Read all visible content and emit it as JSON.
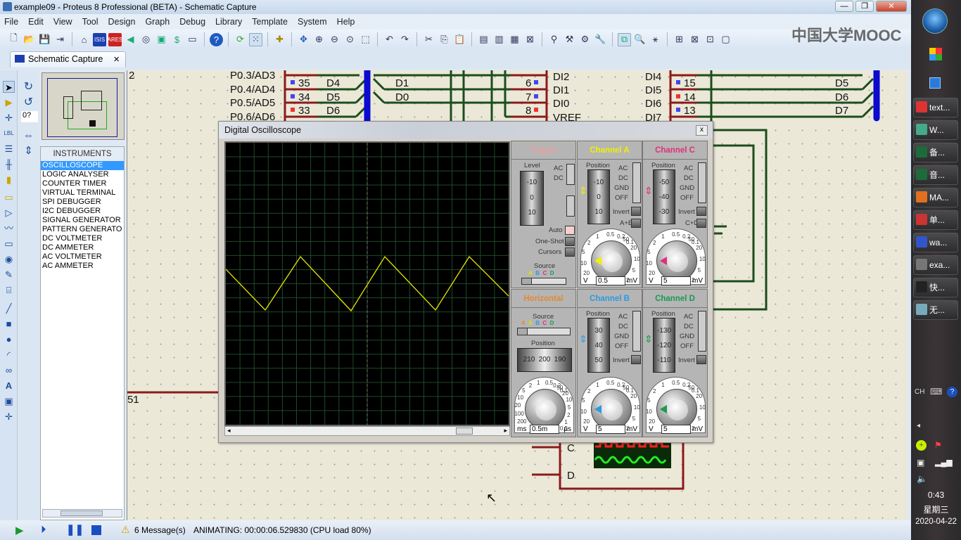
{
  "window": {
    "title": "example09 - Proteus 8 Professional (BETA) - Schematic Capture",
    "minimize": "—",
    "maximize": "❐",
    "close": "✕"
  },
  "menu": [
    "File",
    "Edit",
    "View",
    "Tool",
    "Design",
    "Graph",
    "Debug",
    "Library",
    "Template",
    "System",
    "Help"
  ],
  "watermark": "中国大学MOOC",
  "tab": {
    "label": "Schematic Capture",
    "close": "×"
  },
  "sidebar": {
    "rotation_field": "0?"
  },
  "instruments": {
    "header": "INSTRUMENTS",
    "items": [
      "OSCILLOSCOPE",
      "LOGIC ANALYSER",
      "COUNTER TIMER",
      "VIRTUAL TERMINAL",
      "SPI DEBUGGER",
      "I2C DEBUGGER",
      "SIGNAL GENERATOR",
      "PATTERN GENERATO",
      "DC VOLTMETER",
      "DC AMMETER",
      "AC VOLTMETER",
      "AC AMMETER"
    ],
    "selected": 0
  },
  "schematic": {
    "left_chip_pins": [
      "P0.3/AD3",
      "P0.4/AD4",
      "P0.5/AD5",
      "P0.6/AD6"
    ],
    "left_pin_numbers": [
      "35",
      "34",
      "33"
    ],
    "left_net_labels": [
      "D4",
      "D5",
      "D6"
    ],
    "mid_net_labels": [
      "D1",
      "D0"
    ],
    "adc_pin_numbers": [
      "6",
      "7",
      "8"
    ],
    "adc_left_pins": [
      "DI2",
      "DI1",
      "DI0",
      "VREF"
    ],
    "adc_right_pins": [
      "DI4",
      "DI5",
      "DI6",
      "DI7"
    ],
    "adc_right_numbers": [
      "15",
      "14",
      "13"
    ],
    "right_net_labels": [
      "D5",
      "D6",
      "D7"
    ],
    "edge_label_top": "2",
    "edge_label_bottom": "51",
    "scope_inputs": [
      "C",
      "D"
    ]
  },
  "oscilloscope": {
    "title": "Digital Oscilloscope",
    "close": "x",
    "trigger": {
      "title": "Trigger",
      "level_label": "Level",
      "scale": [
        "-10",
        "0",
        "10"
      ],
      "coupling": [
        "AC",
        "DC"
      ],
      "auto": "Auto",
      "one_shot": "One-Shot",
      "cursors": "Cursors",
      "source_label": "Source",
      "sources": [
        "A",
        "B",
        "C",
        "D"
      ]
    },
    "horizontal": {
      "title": "Horizontal",
      "source_label": "Source",
      "sources": [
        "A",
        "A",
        "B",
        "C",
        "D"
      ],
      "position_label": "Position",
      "scale": [
        "210",
        "200",
        "190"
      ],
      "dial_labels": [
        "200",
        "100",
        "20",
        "10",
        "5",
        "2",
        "1",
        "0.5",
        "0.2",
        "0.1",
        "50",
        "20",
        "10",
        "5",
        "2",
        "1",
        "0.5"
      ],
      "value": "0.5m",
      "unit_left": "ms",
      "unit_right": "µs",
      "color": "#e08a30"
    },
    "channels": [
      {
        "title": "Channel A",
        "color": "#f0f000",
        "scale": [
          "-10",
          "0",
          "10"
        ],
        "extra": "A+B",
        "value": "0.5"
      },
      {
        "title": "Channel C",
        "color": "#e0307a",
        "scale": [
          "-50",
          "-40",
          "-30"
        ],
        "extra": "C+D",
        "value": "5"
      },
      {
        "title": "Channel B",
        "color": "#2a9be0",
        "scale": [
          "30",
          "40",
          "50"
        ],
        "value": "5"
      },
      {
        "title": "Channel D",
        "color": "#1a9a50",
        "scale": [
          "-130",
          "-120",
          "-110"
        ],
        "value": "5"
      }
    ],
    "channel_common": {
      "position_label": "Position",
      "coupling": [
        "AC",
        "DC",
        "GND",
        "OFF"
      ],
      "invert": "Invert",
      "unit_left": "V",
      "unit_right": "mV",
      "dial_labels": [
        "20",
        "10",
        "5",
        "2",
        "1",
        "0.5",
        "0.2",
        "0.1",
        "50",
        "20",
        "10",
        "5",
        "2"
      ]
    },
    "trace_color": "#e8e800"
  },
  "status": {
    "messages": "6 Message(s)",
    "text": "ANIMATING: 00:00:06.529830 (CPU load 80%)"
  },
  "taskbar": {
    "items": [
      {
        "label": "text...",
        "icon": "chrome-icon",
        "color": "#d33"
      },
      {
        "label": "W...",
        "icon": "folder-icon",
        "color": "#4a8"
      },
      {
        "label": "备...",
        "icon": "excel-icon",
        "color": "#1d6b3a"
      },
      {
        "label": "音...",
        "icon": "excel-icon",
        "color": "#1d6b3a"
      },
      {
        "label": "MA...",
        "icon": "matlab-icon",
        "color": "#e07020"
      },
      {
        "label": "单...",
        "icon": "powerpoint-icon",
        "color": "#c33"
      },
      {
        "label": "wa...",
        "icon": "visio-icon",
        "color": "#3355cc"
      },
      {
        "label": "exa...",
        "icon": "proteus-icon",
        "color": "#777"
      },
      {
        "label": "快...",
        "icon": "app-icon",
        "color": "#222"
      },
      {
        "label": "无...",
        "icon": "notepad-icon",
        "color": "#7ab"
      }
    ],
    "ime": "CH",
    "time": "0:43",
    "weekday": "星期三",
    "date": "2020-04-22"
  }
}
